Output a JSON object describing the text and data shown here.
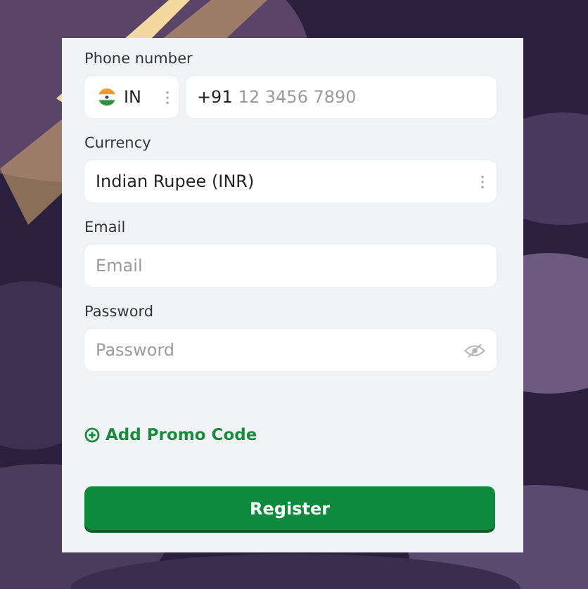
{
  "phone": {
    "label": "Phone number",
    "country_code": "IN",
    "prefix": "+91",
    "placeholder": "12 3456 7890"
  },
  "currency": {
    "label": "Currency",
    "value": "Indian Rupee (INR)"
  },
  "email": {
    "label": "Email",
    "placeholder": "Email"
  },
  "password": {
    "label": "Password",
    "placeholder": "Password"
  },
  "promo_link": {
    "label": "Add Promo Code"
  },
  "register_button": {
    "label": "Register"
  }
}
